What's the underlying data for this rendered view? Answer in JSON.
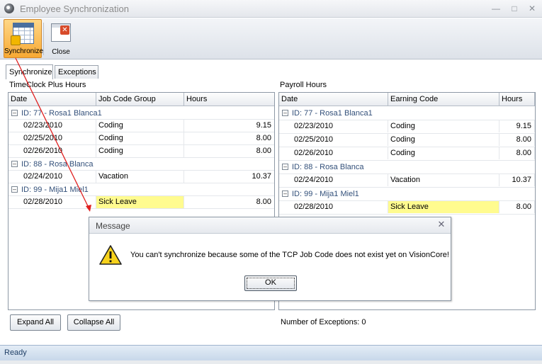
{
  "window": {
    "title": "Employee Synchronization"
  },
  "toolbar": {
    "synchronize_label": "Synchronize",
    "close_label": "Close"
  },
  "tabs": [
    {
      "label": "Synchronize"
    },
    {
      "label": "Exceptions"
    }
  ],
  "left": {
    "title": "TimeClock Plus Hours",
    "columns": [
      "Date",
      "Job Code Group",
      "Hours"
    ],
    "groups": [
      {
        "label": "ID: 77 - Rosa1 Blanca1",
        "rows": [
          {
            "date": "02/23/2010",
            "code": "Coding",
            "hours": "9.15"
          },
          {
            "date": "02/25/2010",
            "code": "Coding",
            "hours": "8.00"
          },
          {
            "date": "02/26/2010",
            "code": "Coding",
            "hours": "8.00"
          }
        ]
      },
      {
        "label": "ID: 88 - Rosa Blanca",
        "rows": [
          {
            "date": "02/24/2010",
            "code": "Vacation",
            "hours": "10.37"
          }
        ]
      },
      {
        "label": "ID: 99 - Mija1 Miel1",
        "rows": [
          {
            "date": "02/28/2010",
            "code": "Sick Leave",
            "hours": "8.00"
          }
        ]
      }
    ]
  },
  "right": {
    "title": "Payroll Hours",
    "columns": [
      "Date",
      "Earning Code",
      "Hours"
    ],
    "groups": [
      {
        "label": "ID: 77 - Rosa1 Blanca1",
        "rows": [
          {
            "date": "02/23/2010",
            "code": "Coding",
            "hours": "9.15"
          },
          {
            "date": "02/25/2010",
            "code": "Coding",
            "hours": "8.00"
          },
          {
            "date": "02/26/2010",
            "code": "Coding",
            "hours": "8.00"
          }
        ]
      },
      {
        "label": "ID: 88 - Rosa Blanca",
        "rows": [
          {
            "date": "02/24/2010",
            "code": "Vacation",
            "hours": "10.37"
          }
        ]
      },
      {
        "label": "ID: 99 - Mija1 Miel1",
        "rows": [
          {
            "date": "02/28/2010",
            "code": "Sick Leave",
            "hours": "8.00"
          }
        ]
      }
    ]
  },
  "buttons": {
    "expand_all": "Expand All",
    "collapse_all": "Collapse All"
  },
  "exceptions_text": "Number of Exceptions: 0",
  "status": {
    "text": "Ready"
  },
  "dialog": {
    "title": "Message",
    "message": "You can't synchronize because some of the TCP Job Code does not exist yet on VisionCore!",
    "ok_label": "OK"
  },
  "colors": {
    "highlight": "#fffb8f",
    "group_text": "#33507a",
    "toolbar_active": "#f7a933",
    "arrow": "#e02020"
  },
  "icons": {
    "synchronize": "spreadsheet-sync-icon",
    "close": "close-window-icon",
    "warning": "warning-icon",
    "group_toggle": "collapse-minus-icon"
  }
}
